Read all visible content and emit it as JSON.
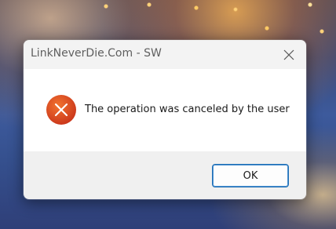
{
  "dialog": {
    "title": "LinkNeverDie.Com - SW",
    "close_icon": "close-icon",
    "error_icon": "error-x-icon",
    "message": "The operation was canceled by the user",
    "ok_label": "OK"
  },
  "colors": {
    "error_red": "#e04a1c",
    "button_border": "#1f6fb5",
    "titlebar_bg": "#f3f3f3",
    "footer_bg": "#f0f0f0"
  }
}
